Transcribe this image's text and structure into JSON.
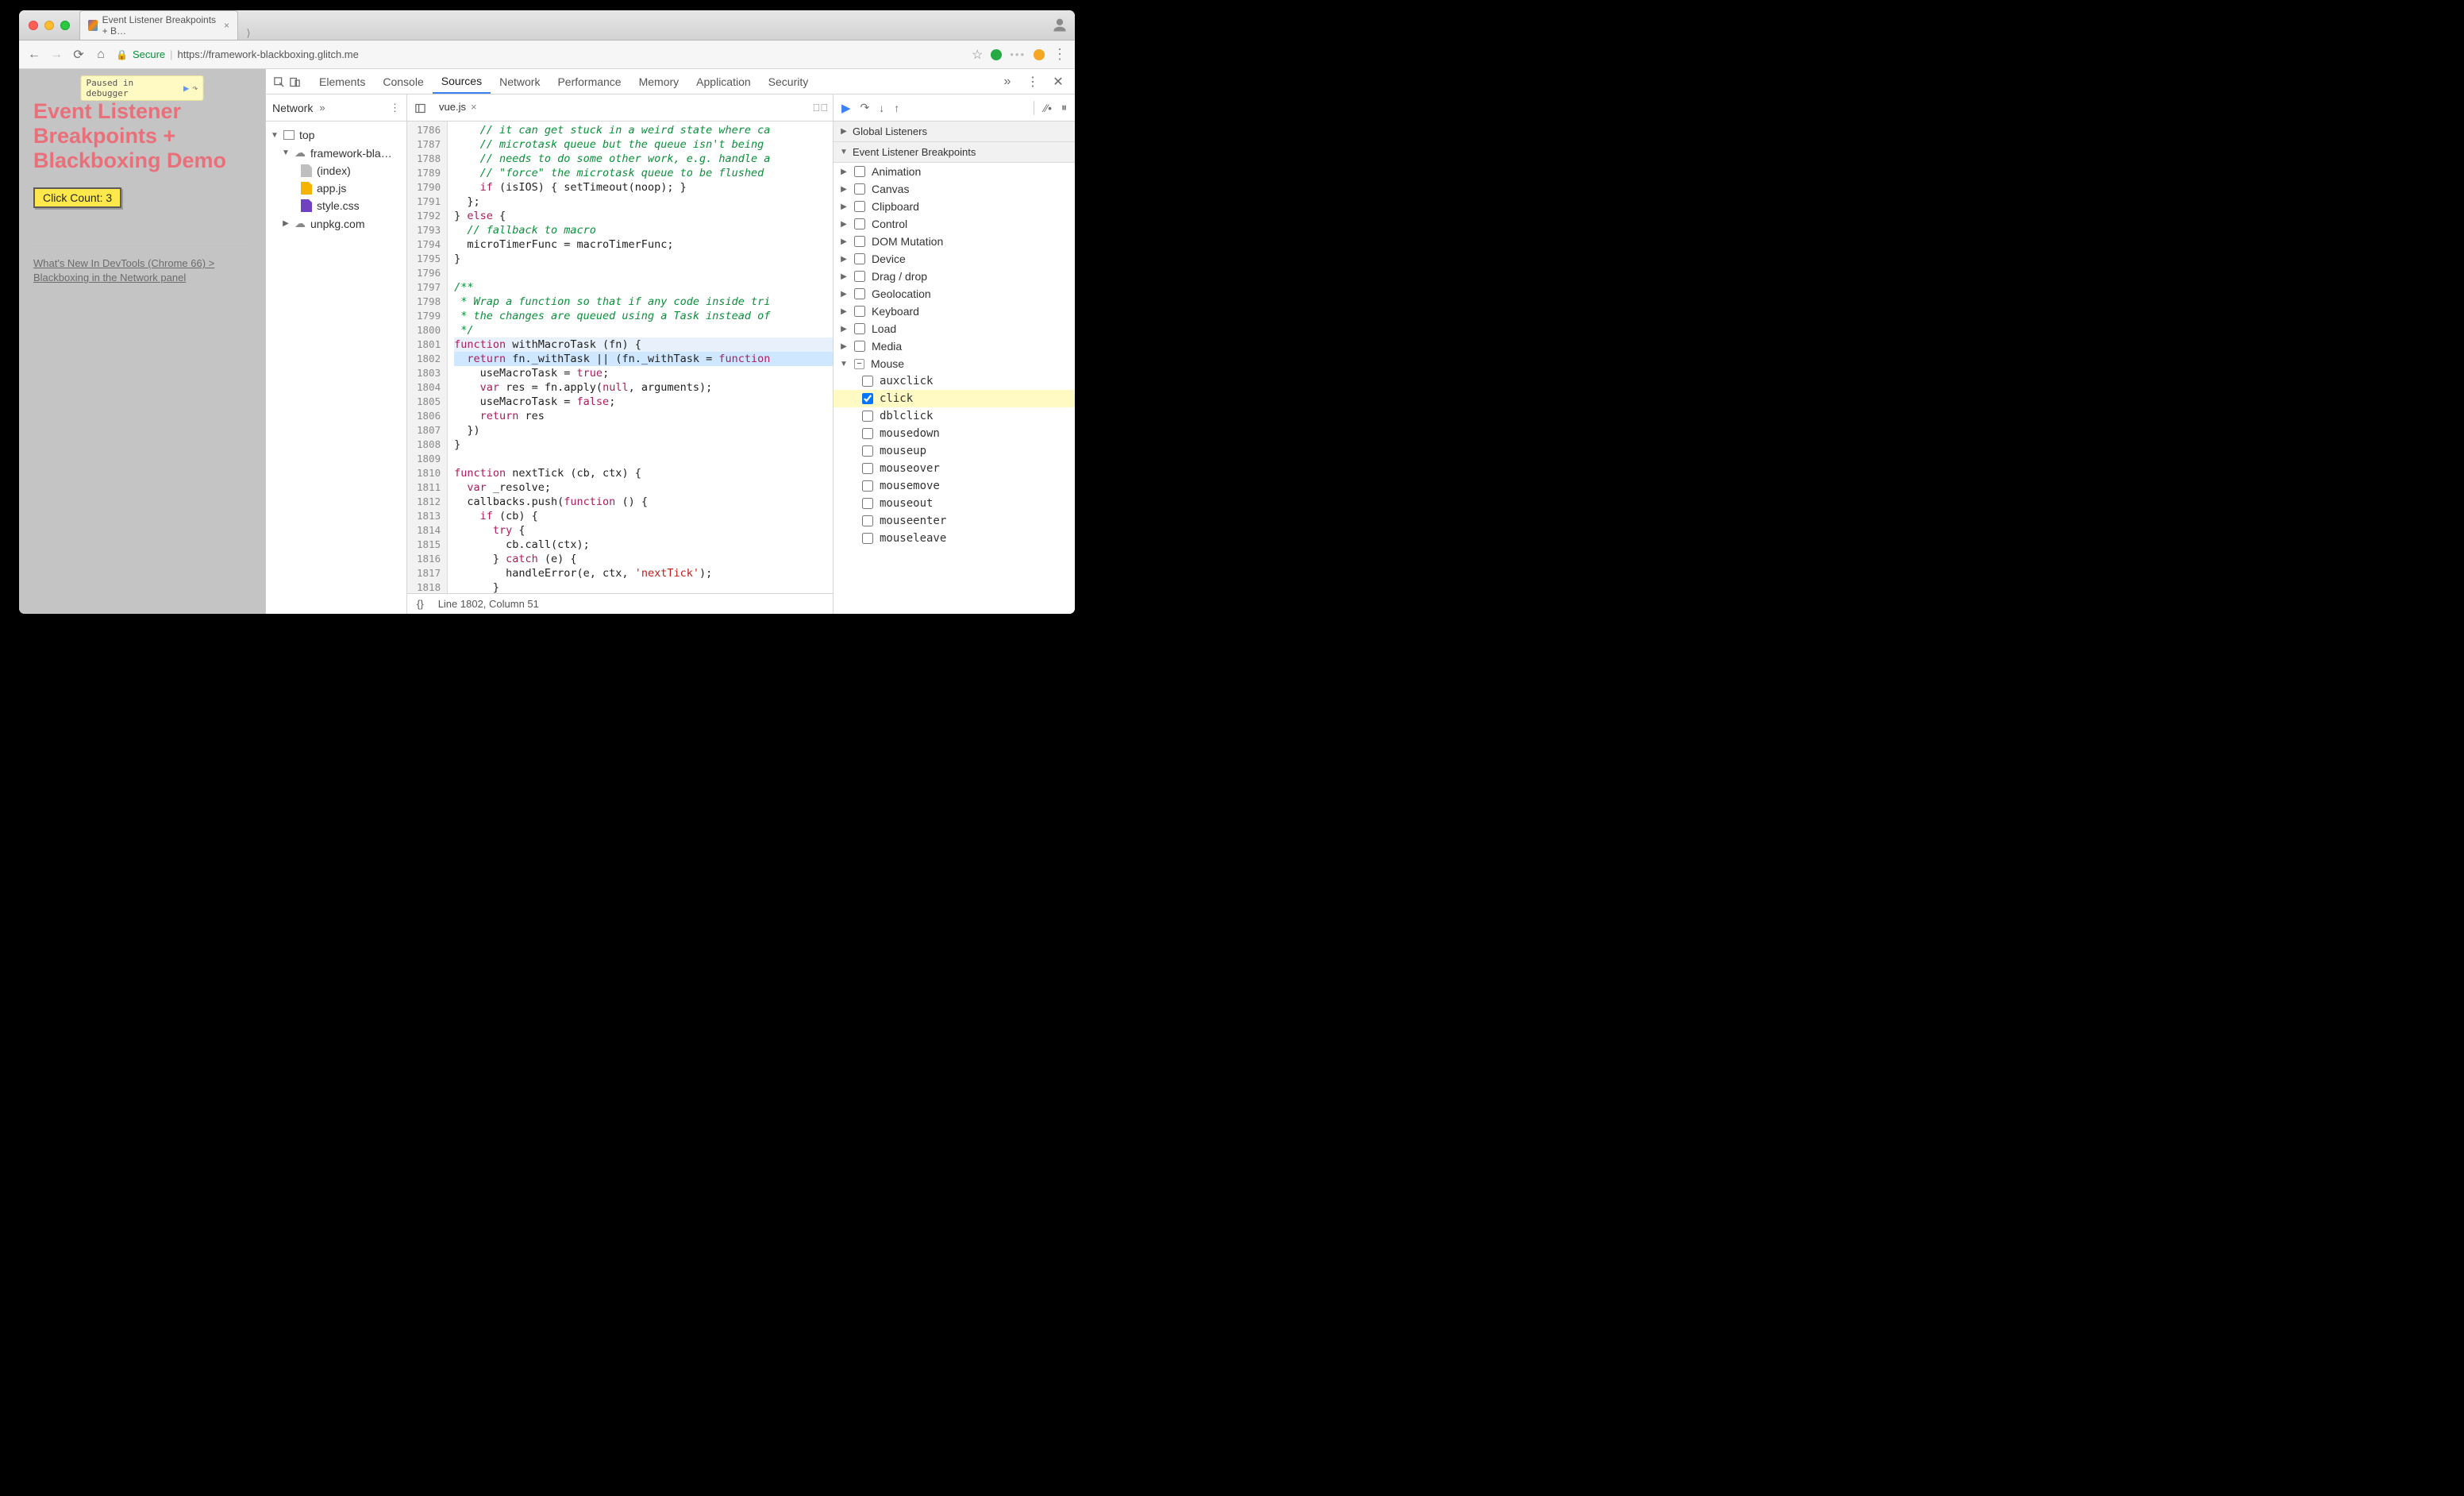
{
  "browser": {
    "tab_title": "Event Listener Breakpoints + B…",
    "secure_label": "Secure",
    "url_display": "https://framework-blackboxing.glitch.me"
  },
  "page": {
    "paused_text": "Paused in debugger",
    "heading": "Event Listener Breakpoints + Blackboxing Demo",
    "click_button": "Click Count: 3",
    "article_link": "What's New In DevTools (Chrome 66) > Blackboxing in the Network panel"
  },
  "devtools": {
    "tabs": [
      "Elements",
      "Console",
      "Sources",
      "Network",
      "Performance",
      "Memory",
      "Application",
      "Security"
    ],
    "active_tab": "Sources",
    "navigator": {
      "primary_tab": "Network",
      "tree": {
        "top": "top",
        "origin": "framework-bla…",
        "files": [
          "(index)",
          "app.js",
          "style.css"
        ],
        "external": "unpkg.com"
      }
    },
    "editor": {
      "open_file": "vue.js",
      "status": "Line 1802, Column 51",
      "pretty_label": "{}",
      "gutter_start": 1786,
      "gutter_end": 1818,
      "highlight_line": 1802,
      "lines": [
        "    // it can get stuck in a weird state where ca",
        "    // microtask queue but the queue isn't being ",
        "    // needs to do some other work, e.g. handle a",
        "    // \"force\" the microtask queue to be flushed",
        "    if (isIOS) { setTimeout(noop); }",
        "  };",
        "} else {",
        "  // fallback to macro",
        "  microTimerFunc = macroTimerFunc;",
        "}",
        "",
        "/**",
        " * Wrap a function so that if any code inside tri",
        " * the changes are queued using a Task instead of",
        " */",
        "function withMacroTask (fn) {",
        "  return fn._withTask || (fn._withTask = function",
        "    useMacroTask = true;",
        "    var res = fn.apply(null, arguments);",
        "    useMacroTask = false;",
        "    return res",
        "  })",
        "} ",
        "",
        "function nextTick (cb, ctx) {",
        "  var _resolve;",
        "  callbacks.push(function () {",
        "    if (cb) {",
        "      try {",
        "        cb.call(ctx);",
        "      } catch (e) {",
        "        handleError(e, ctx, 'nextTick');",
        "      }"
      ]
    },
    "side": {
      "global_listeners": "Global Listeners",
      "elb_title": "Event Listener Breakpoints",
      "categories": [
        {
          "name": "Animation",
          "checked": false,
          "expanded": false
        },
        {
          "name": "Canvas",
          "checked": false,
          "expanded": false
        },
        {
          "name": "Clipboard",
          "checked": false,
          "expanded": false
        },
        {
          "name": "Control",
          "checked": false,
          "expanded": false
        },
        {
          "name": "DOM Mutation",
          "checked": false,
          "expanded": false
        },
        {
          "name": "Device",
          "checked": false,
          "expanded": false
        },
        {
          "name": "Drag / drop",
          "checked": false,
          "expanded": false
        },
        {
          "name": "Geolocation",
          "checked": false,
          "expanded": false
        },
        {
          "name": "Keyboard",
          "checked": false,
          "expanded": false
        },
        {
          "name": "Load",
          "checked": false,
          "expanded": false
        },
        {
          "name": "Media",
          "checked": false,
          "expanded": false
        }
      ],
      "mouse": {
        "name": "Mouse",
        "events": [
          {
            "name": "auxclick",
            "checked": false
          },
          {
            "name": "click",
            "checked": true
          },
          {
            "name": "dblclick",
            "checked": false
          },
          {
            "name": "mousedown",
            "checked": false
          },
          {
            "name": "mouseup",
            "checked": false
          },
          {
            "name": "mouseover",
            "checked": false
          },
          {
            "name": "mousemove",
            "checked": false
          },
          {
            "name": "mouseout",
            "checked": false
          },
          {
            "name": "mouseenter",
            "checked": false
          },
          {
            "name": "mouseleave",
            "checked": false
          }
        ]
      }
    }
  }
}
